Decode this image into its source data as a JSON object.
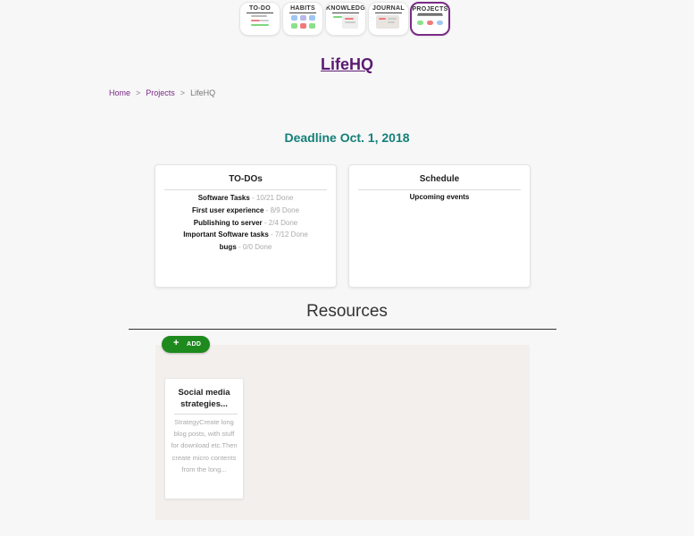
{
  "nav": [
    {
      "label": "TO-DO",
      "icon": "todo-icon"
    },
    {
      "label": "HABITS",
      "icon": "habits-icon"
    },
    {
      "label": "KNOWLEDGE",
      "icon": "knowledge-icon"
    },
    {
      "label": "JOURNAL",
      "icon": "journal-icon"
    },
    {
      "label": "PROJECTS",
      "icon": "projects-icon",
      "active": true
    }
  ],
  "page": {
    "title": "LifeHQ",
    "deadline": "Deadline Oct. 1, 2018"
  },
  "breadcrumb": {
    "home": "Home",
    "projects": "Projects",
    "current": "LifeHQ",
    "separator": ">"
  },
  "todos": {
    "title": "TO-DOs",
    "items": [
      {
        "name": "Software Tasks",
        "count": " - 10/21 Done"
      },
      {
        "name": "First user experience",
        "count": " - 8/9 Done"
      },
      {
        "name": "Publishing to server",
        "count": " - 2/4 Done"
      },
      {
        "name": "Important Software tasks",
        "count": " - 7/12 Done"
      },
      {
        "name": "bugs",
        "count": " - 0/0 Done"
      }
    ]
  },
  "schedule": {
    "title": "Schedule",
    "upcoming": "Upcoming events"
  },
  "resources": {
    "title": "Resources",
    "add_label": "ADD",
    "add_icon": "plus-icon",
    "cards": [
      {
        "title": "Social media strategies...",
        "description": "StrategyCreate long blog posts, with stuff for download etc.Then create micro contents from the long..."
      }
    ]
  },
  "colors": {
    "accent": "#7a2a86",
    "title": "#5b1a72",
    "deadline": "#138078",
    "add_button": "#1e8a1e"
  }
}
